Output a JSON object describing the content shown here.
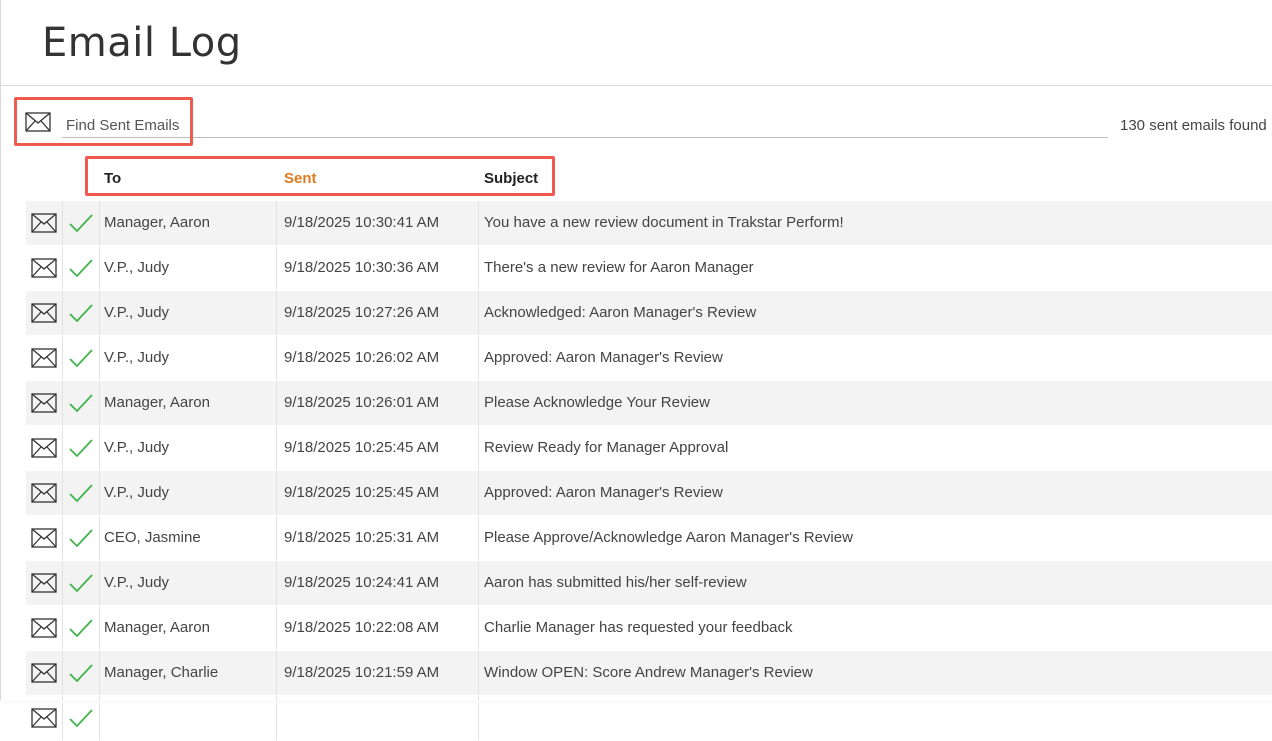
{
  "page": {
    "title": "Email Log"
  },
  "search": {
    "placeholder": "Find Sent Emails",
    "value": "",
    "result_count": "130 sent emails found"
  },
  "columns": {
    "to": "To",
    "sent": "Sent",
    "subject": "Subject"
  },
  "colors": {
    "sort_accent": "#e07a1f",
    "success_check": "#3fb54b",
    "highlight": "#ef5a4e"
  },
  "rows": [
    {
      "to": "Manager, Aaron",
      "sent": "9/18/2025 10:30:41 AM",
      "subject": "You have a new review document in Trakstar Perform!"
    },
    {
      "to": "V.P., Judy",
      "sent": "9/18/2025 10:30:36 AM",
      "subject": "There's a new review for Aaron Manager"
    },
    {
      "to": "V.P., Judy",
      "sent": "9/18/2025 10:27:26 AM",
      "subject": "Acknowledged: Aaron Manager's Review"
    },
    {
      "to": "V.P., Judy",
      "sent": "9/18/2025 10:26:02 AM",
      "subject": "Approved: Aaron Manager's Review"
    },
    {
      "to": "Manager, Aaron",
      "sent": "9/18/2025 10:26:01 AM",
      "subject": "Please Acknowledge Your Review"
    },
    {
      "to": "V.P., Judy",
      "sent": "9/18/2025 10:25:45 AM",
      "subject": "Review Ready for Manager Approval"
    },
    {
      "to": "V.P., Judy",
      "sent": "9/18/2025 10:25:45 AM",
      "subject": "Approved: Aaron Manager's Review"
    },
    {
      "to": "CEO, Jasmine",
      "sent": "9/18/2025 10:25:31 AM",
      "subject": "Please Approve/Acknowledge Aaron Manager's Review"
    },
    {
      "to": "V.P., Judy",
      "sent": "9/18/2025 10:24:41 AM",
      "subject": "Aaron has submitted his/her self-review"
    },
    {
      "to": "Manager, Aaron",
      "sent": "9/18/2025 10:22:08 AM",
      "subject": "Charlie Manager has requested your feedback"
    },
    {
      "to": "Manager, Charlie",
      "sent": "9/18/2025 10:21:59 AM",
      "subject": "Window OPEN: Score Andrew Manager's Review"
    },
    {
      "to": "",
      "sent": "",
      "subject": ""
    }
  ]
}
